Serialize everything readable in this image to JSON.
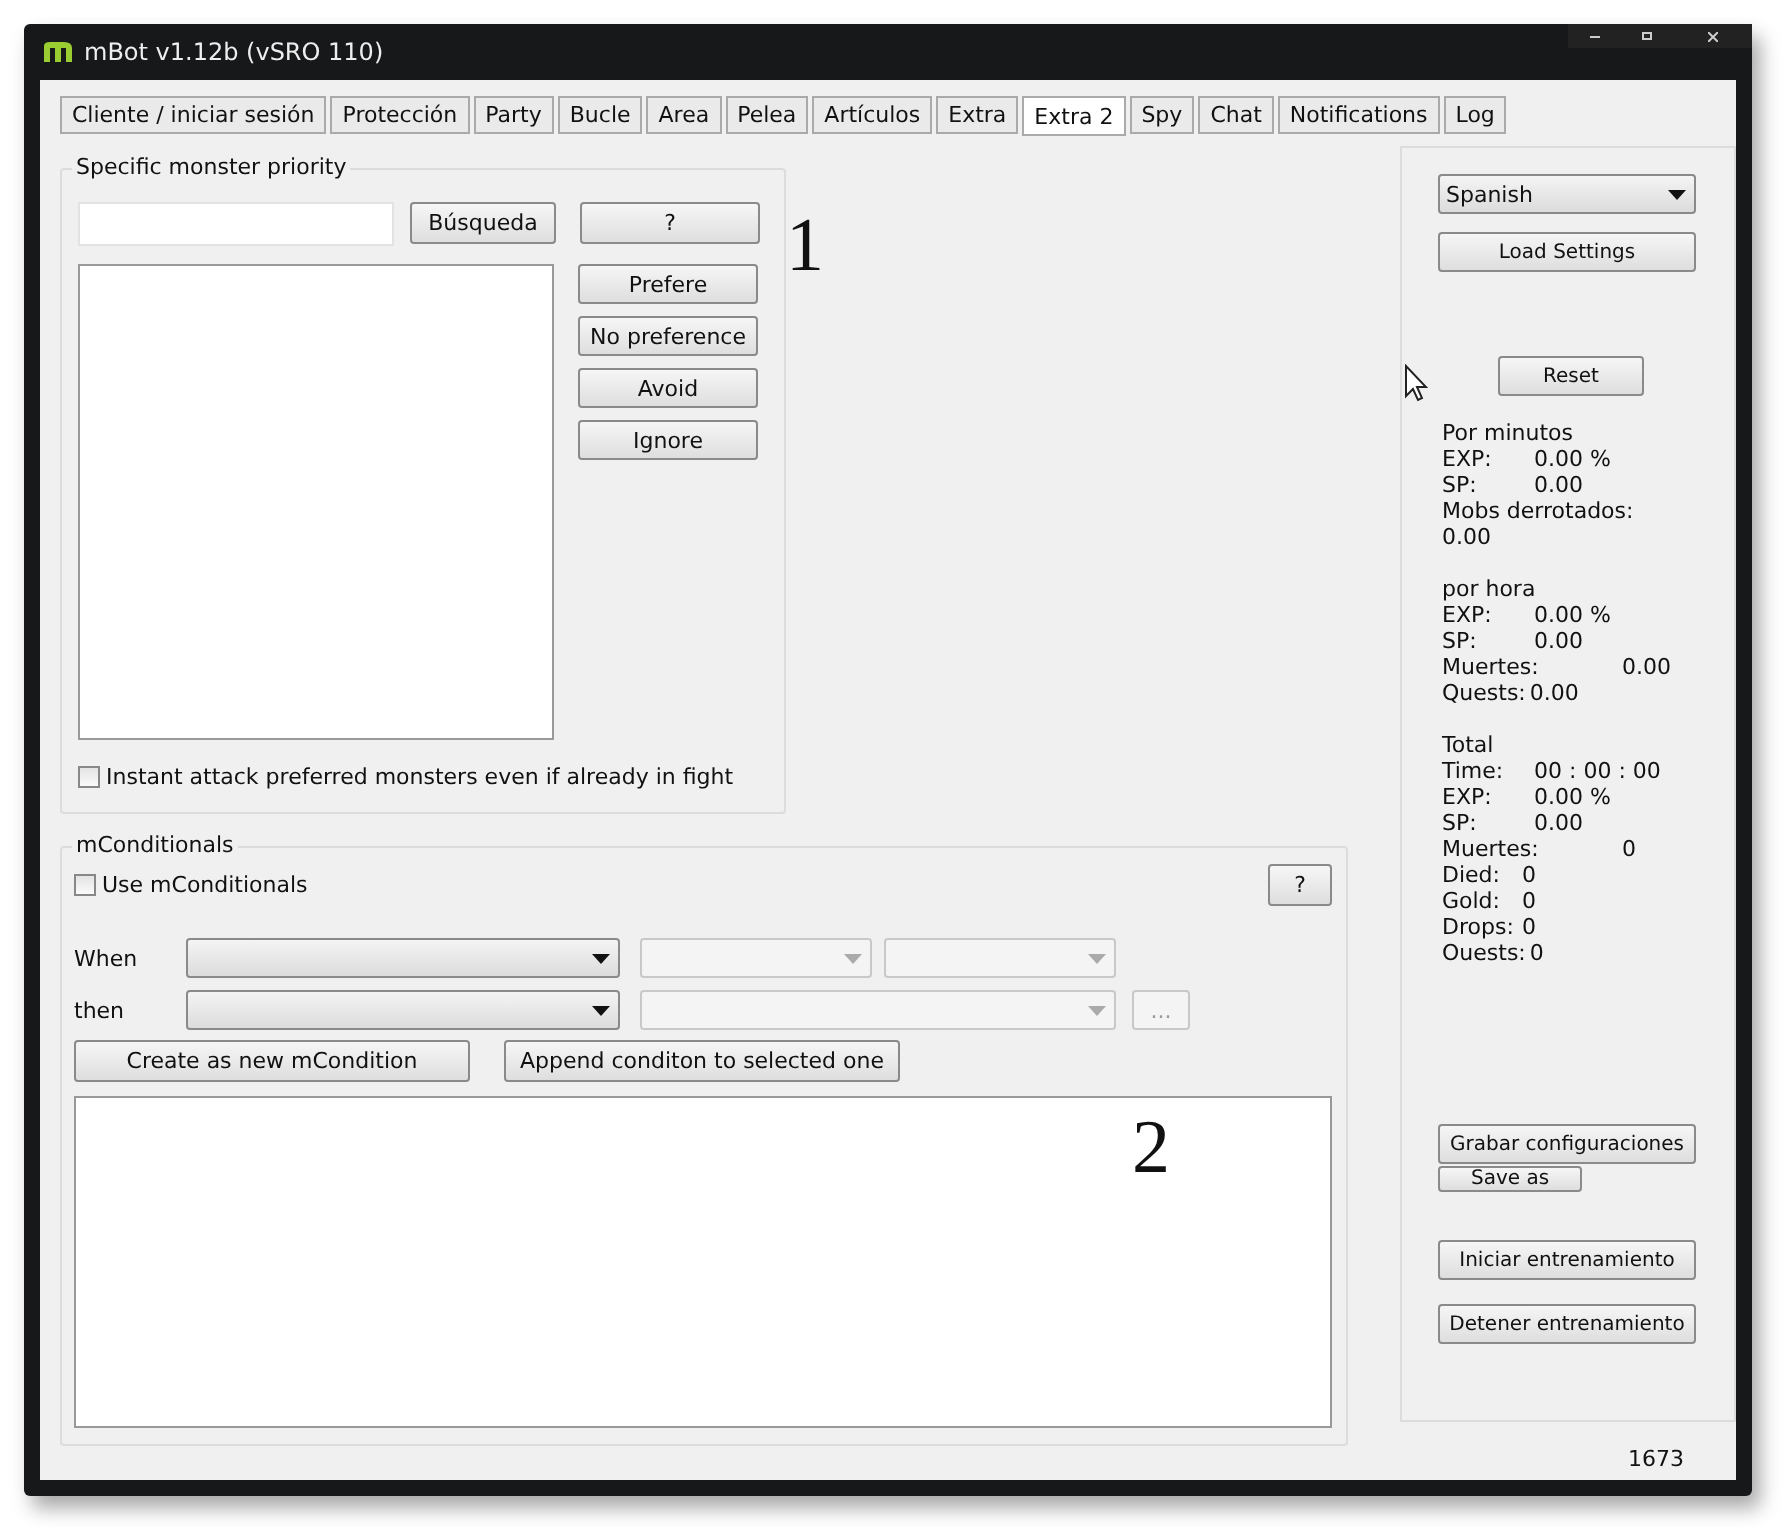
{
  "window": {
    "title": "mBot v1.12b (vSRO 110)"
  },
  "tabs": [
    {
      "label": "Cliente / iniciar sesión",
      "selected": false
    },
    {
      "label": "Protección",
      "selected": false
    },
    {
      "label": "Party",
      "selected": false
    },
    {
      "label": "Bucle",
      "selected": false
    },
    {
      "label": "Area",
      "selected": false
    },
    {
      "label": "Pelea",
      "selected": false
    },
    {
      "label": "Artículos",
      "selected": false
    },
    {
      "label": "Extra",
      "selected": false
    },
    {
      "label": "Extra 2",
      "selected": true
    },
    {
      "label": "Spy",
      "selected": false
    },
    {
      "label": "Chat",
      "selected": false
    },
    {
      "label": "Notifications",
      "selected": false
    },
    {
      "label": "Log",
      "selected": false
    }
  ],
  "monster_priority": {
    "title": "Specific monster priority",
    "search_button": "Búsqueda",
    "help_button": "?",
    "buttons": [
      "Prefere",
      "No preference",
      "Avoid",
      "Ignore"
    ],
    "instant_attack": {
      "label": "Instant attack preferred monsters even if already in fight",
      "checked": false
    }
  },
  "annotations": [
    "1",
    "2"
  ],
  "mconditionals": {
    "title": "mConditionals",
    "use": {
      "label": "Use mConditionals",
      "checked": false
    },
    "help_button": "?",
    "when_label": "When",
    "then_label": "then",
    "more_button": "...",
    "create_button": "Create as new mCondition",
    "append_button": "Append conditon to selected one"
  },
  "side_panel": {
    "language": "Spanish",
    "load_button": "Load Settings",
    "reset_button": "Reset",
    "stats": [
      {
        "title": "Por minutos",
        "rows": [
          {
            "kind": "column",
            "label": "EXP:",
            "value": "0.00 %"
          },
          {
            "kind": "column",
            "label": "SP:",
            "value": "0.00"
          },
          {
            "kind": "stacked",
            "label": "Mobs derrotados:",
            "value": "0.00"
          }
        ]
      },
      {
        "title": "por hora",
        "rows": [
          {
            "kind": "column",
            "label": "EXP:",
            "value": "0.00 %"
          },
          {
            "kind": "column",
            "label": "SP:",
            "value": "0.00"
          },
          {
            "kind": "wide",
            "label": "Muertes:",
            "value": "0.00"
          },
          {
            "kind": "tight",
            "label": "Quests:",
            "value": "0.00"
          }
        ]
      },
      {
        "title": "Total",
        "rows": [
          {
            "kind": "column",
            "label": "Time:",
            "value": "00 : 00 : 00"
          },
          {
            "kind": "column",
            "label": "EXP:",
            "value": "0.00 %"
          },
          {
            "kind": "column",
            "label": "SP:",
            "value": "0.00"
          },
          {
            "kind": "wide",
            "label": "Muertes:",
            "value": "0"
          },
          {
            "kind": "short",
            "label": "Died:",
            "value": "0"
          },
          {
            "kind": "short",
            "label": "Gold:",
            "value": "0"
          },
          {
            "kind": "short",
            "label": "Drops:",
            "value": "0"
          },
          {
            "kind": "tight",
            "label": "Ouests:",
            "value": "0"
          }
        ]
      }
    ],
    "save_button": "Grabar configuraciones",
    "save_as_button": "Save as",
    "start_button": "Iniciar entrenamiento",
    "stop_button": "Detener entrenamiento"
  },
  "status_bar": {
    "count": "1673"
  }
}
